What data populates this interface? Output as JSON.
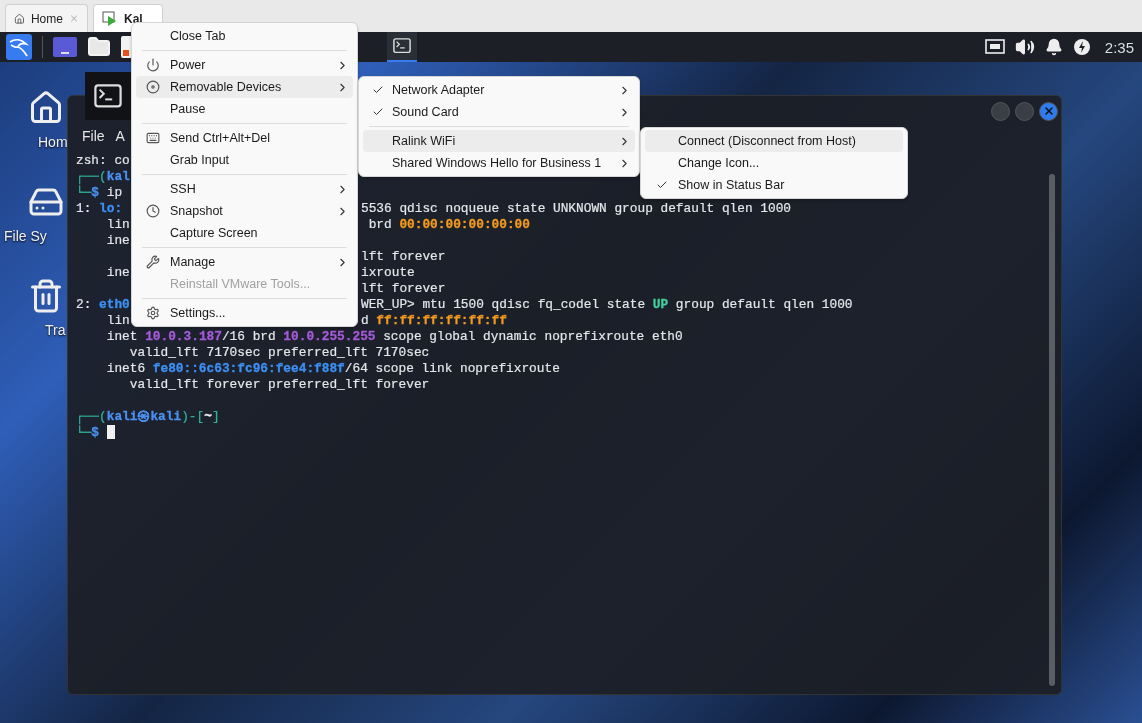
{
  "tabs": [
    {
      "label": "Home",
      "kind": "home",
      "selected": false,
      "closable": true
    },
    {
      "label": "Kal",
      "kind": "vm",
      "selected": true,
      "closable": false
    }
  ],
  "panel": {
    "clock": "2:35"
  },
  "desktop_icons": [
    {
      "label": "Hom",
      "kind": "home"
    },
    {
      "label": "File Sy",
      "kind": "drive"
    },
    {
      "label": "Tra",
      "kind": "trash"
    }
  ],
  "terminal": {
    "menu": [
      "File",
      "A"
    ],
    "lines": [
      {
        "kind": "text",
        "left": [
          {
            "text": "zsh: co",
            "color": "#e4e6ea",
            "bold": false
          }
        ]
      },
      {
        "kind": "text",
        "left": [
          {
            "text": "┌──(",
            "color": "#2fb39b",
            "bold": false
          },
          {
            "text": "kal",
            "color": "#4b90f0",
            "bold": true
          }
        ]
      },
      {
        "kind": "text",
        "left": [
          {
            "text": "└─",
            "color": "#2fb39b",
            "bold": true
          },
          {
            "text": "$",
            "color": "#4b90f0",
            "bold": true
          },
          {
            "text": " ip",
            "color": "#e4e6ea",
            "bold": false
          }
        ]
      },
      {
        "kind": "text",
        "left": [
          {
            "text": "1: ",
            "color": "#e4e6ea",
            "bold": false
          },
          {
            "text": "lo:",
            "color": "#3d8ff2",
            "bold": true
          }
        ],
        "right": [
          {
            "text": "5536 qdisc noqueue state UNKNOWN group default qlen 1000",
            "color": "#e4e6ea",
            "bold": false
          }
        ]
      },
      {
        "kind": "text",
        "left": [
          {
            "text": "    lin",
            "color": "#e4e6ea",
            "bold": false
          }
        ],
        "right": [
          {
            "text": " brd ",
            "color": "#e4e6ea",
            "bold": false
          },
          {
            "text": "00:00:00:00:00:00",
            "color": "#f39a1f",
            "bold": true
          }
        ]
      },
      {
        "kind": "text",
        "left": [
          {
            "text": "    ine",
            "color": "#e4e6ea",
            "bold": false
          }
        ]
      },
      {
        "kind": "text",
        "right": [
          {
            "text": "lft forever",
            "color": "#e4e6ea",
            "bold": false
          }
        ]
      },
      {
        "kind": "text",
        "left": [
          {
            "text": "    ine",
            "color": "#e4e6ea",
            "bold": false
          }
        ],
        "right": [
          {
            "text": "ixroute",
            "color": "#e4e6ea",
            "bold": false
          }
        ]
      },
      {
        "kind": "text",
        "right": [
          {
            "text": "lft forever",
            "color": "#e4e6ea",
            "bold": false
          }
        ]
      },
      {
        "kind": "text",
        "left": [
          {
            "text": "2: ",
            "color": "#e4e6ea",
            "bold": false
          },
          {
            "text": "eth0",
            "color": "#3d8ff2",
            "bold": true
          }
        ],
        "right": [
          {
            "text": "WER_UP> mtu 1500 qdisc fq_codel state ",
            "color": "#e4e6ea",
            "bold": false
          },
          {
            "text": "UP",
            "color": "#3fcf9c",
            "bold": true
          },
          {
            "text": " group default qlen 1000",
            "color": "#e4e6ea",
            "bold": false
          }
        ]
      },
      {
        "kind": "text",
        "left": [
          {
            "text": "    lin",
            "color": "#e4e6ea",
            "bold": false
          }
        ],
        "right": [
          {
            "text": "d ",
            "color": "#e4e6ea",
            "bold": false
          },
          {
            "text": "ff:ff:ff:ff:ff:ff",
            "color": "#f39a1f",
            "bold": true
          }
        ]
      },
      {
        "kind": "text",
        "left": [
          {
            "text": "    inet ",
            "color": "#e4e6ea",
            "bold": false
          },
          {
            "text": "10.0.3.187",
            "color": "#a55ad8",
            "bold": true
          },
          {
            "text": "/16 brd ",
            "color": "#e4e6ea",
            "bold": false
          },
          {
            "text": "10.0.255.255",
            "color": "#a55ad8",
            "bold": true
          },
          {
            "text": " scope global dynamic noprefixroute eth0",
            "color": "#e4e6ea",
            "bold": false
          }
        ]
      },
      {
        "kind": "text",
        "left": [
          {
            "text": "       valid_lft 7170sec preferred_lft 7170sec",
            "color": "#e4e6ea",
            "bold": false
          }
        ]
      },
      {
        "kind": "text",
        "left": [
          {
            "text": "    inet6 ",
            "color": "#e4e6ea",
            "bold": false
          },
          {
            "text": "fe80::6c63:fc96:fee4:f88f",
            "color": "#3d8ff2",
            "bold": true
          },
          {
            "text": "/64 scope link noprefixroute",
            "color": "#e4e6ea",
            "bold": false
          }
        ]
      },
      {
        "kind": "text",
        "left": [
          {
            "text": "       valid_lft forever preferred_lft forever",
            "color": "#e4e6ea",
            "bold": false
          }
        ]
      },
      {
        "kind": "blank"
      },
      {
        "kind": "text",
        "left": [
          {
            "text": "┌──(",
            "color": "#2fb39b",
            "bold": false
          },
          {
            "text": "kali㉿kali",
            "color": "#4b90f0",
            "bold": true
          },
          {
            "text": ")-[",
            "color": "#2fb39b",
            "bold": false
          },
          {
            "text": "~",
            "color": "#f0f0f0",
            "bold": true
          },
          {
            "text": "]",
            "color": "#2fb39b",
            "bold": false
          }
        ]
      },
      {
        "kind": "prompt",
        "left": [
          {
            "text": "└─",
            "color": "#2fb39b",
            "bold": true
          },
          {
            "text": "$",
            "color": "#4b90f0",
            "bold": true
          }
        ]
      }
    ]
  },
  "context_menu": {
    "groups": [
      [
        {
          "label": "Close Tab",
          "kind": "none",
          "submenu": false,
          "disabled": false,
          "selected": false
        }
      ],
      [
        {
          "label": "Power",
          "kind": "power",
          "submenu": true,
          "disabled": false,
          "selected": false
        },
        {
          "label": "Removable Devices",
          "kind": "disc",
          "submenu": true,
          "disabled": false,
          "selected": true
        },
        {
          "label": "Pause",
          "kind": "none",
          "submenu": false,
          "disabled": false,
          "selected": false
        }
      ],
      [
        {
          "label": "Send Ctrl+Alt+Del",
          "kind": "keyboard",
          "submenu": false,
          "disabled": false,
          "selected": false
        },
        {
          "label": "Grab Input",
          "kind": "none",
          "submenu": false,
          "disabled": false,
          "selected": false
        }
      ],
      [
        {
          "label": "SSH",
          "kind": "none",
          "submenu": true,
          "disabled": false,
          "selected": false
        },
        {
          "label": "Snapshot",
          "kind": "clock",
          "submenu": true,
          "disabled": false,
          "selected": false
        },
        {
          "label": "Capture Screen",
          "kind": "none",
          "submenu": false,
          "disabled": false,
          "selected": false
        }
      ],
      [
        {
          "label": "Manage",
          "kind": "wrench",
          "submenu": true,
          "disabled": false,
          "selected": false
        },
        {
          "label": "Reinstall VMware Tools...",
          "kind": "none",
          "submenu": false,
          "disabled": true,
          "selected": false
        }
      ],
      [
        {
          "label": "Settings...",
          "kind": "gear",
          "submenu": false,
          "disabled": false,
          "selected": false
        }
      ]
    ]
  },
  "devices_menu": {
    "groups": [
      [
        {
          "label": "Network Adapter",
          "checked": true,
          "submenu": true,
          "selected": false
        },
        {
          "label": "Sound Card",
          "checked": true,
          "submenu": true,
          "selected": false
        }
      ],
      [
        {
          "label": "Ralink WiFi",
          "checked": false,
          "submenu": true,
          "selected": true
        },
        {
          "label": "Shared Windows Hello for Business 1",
          "checked": false,
          "submenu": true,
          "selected": false
        }
      ]
    ]
  },
  "device_menu": {
    "groups": [
      [
        {
          "label": "Connect (Disconnect from Host)",
          "checked": false,
          "submenu": false,
          "selected": true
        },
        {
          "label": "Change Icon...",
          "checked": false,
          "submenu": false,
          "selected": false
        },
        {
          "label": "Show in Status Bar",
          "checked": true,
          "submenu": false,
          "selected": false
        }
      ]
    ]
  }
}
